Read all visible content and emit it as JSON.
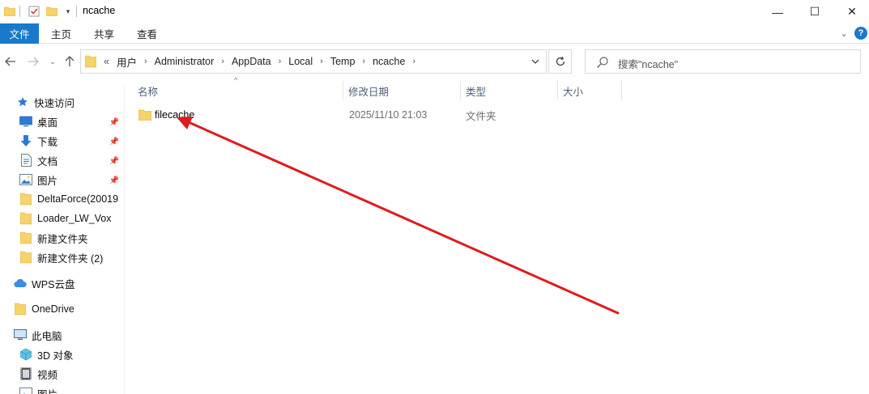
{
  "window": {
    "title": "ncache",
    "controls": {
      "minimize": "—",
      "maximize": "☐",
      "close": "✕"
    }
  },
  "ribbon": {
    "tabs": [
      "文件",
      "主页",
      "共享",
      "查看"
    ],
    "expand_icon": "chevron-down-icon",
    "help": "?"
  },
  "address": {
    "overflow": "«",
    "crumbs": [
      "用户",
      "Administrator",
      "AppData",
      "Local",
      "Temp",
      "ncache"
    ]
  },
  "search": {
    "placeholder": "搜索\"ncache\""
  },
  "nav": {
    "quick_access": "快速访问",
    "quick_items": [
      {
        "label": "桌面",
        "icon": "desktop-icon",
        "pinned": true
      },
      {
        "label": "下载",
        "icon": "download-icon",
        "pinned": true
      },
      {
        "label": "文档",
        "icon": "document-icon",
        "pinned": true
      },
      {
        "label": "图片",
        "icon": "picture-icon",
        "pinned": true
      },
      {
        "label": "DeltaForce(20019",
        "icon": "folder-icon",
        "pinned": false
      },
      {
        "label": "Loader_LW_Vox",
        "icon": "folder-icon",
        "pinned": false
      },
      {
        "label": "新建文件夹",
        "icon": "folder-icon",
        "pinned": false
      },
      {
        "label": "新建文件夹 (2)",
        "icon": "folder-icon",
        "pinned": false
      }
    ],
    "wps": "WPS云盘",
    "onedrive": "OneDrive",
    "this_pc": "此电脑",
    "pc_items": [
      {
        "label": "3D 对象",
        "icon": "3d-objects-icon"
      },
      {
        "label": "视频",
        "icon": "video-icon"
      },
      {
        "label": "图片",
        "icon": "picture-icon"
      }
    ]
  },
  "columns": {
    "name": "名称",
    "modified": "修改日期",
    "type": "类型",
    "size": "大小"
  },
  "files": [
    {
      "name": "filecache",
      "modified": "2025/11/10 21:03",
      "type": "文件夹",
      "size": ""
    }
  ],
  "colors": {
    "accent": "#1979ca",
    "folder": "#f6d36b",
    "annotation_arrow": "#e01b1b",
    "column_header_text": "#4c607a"
  }
}
